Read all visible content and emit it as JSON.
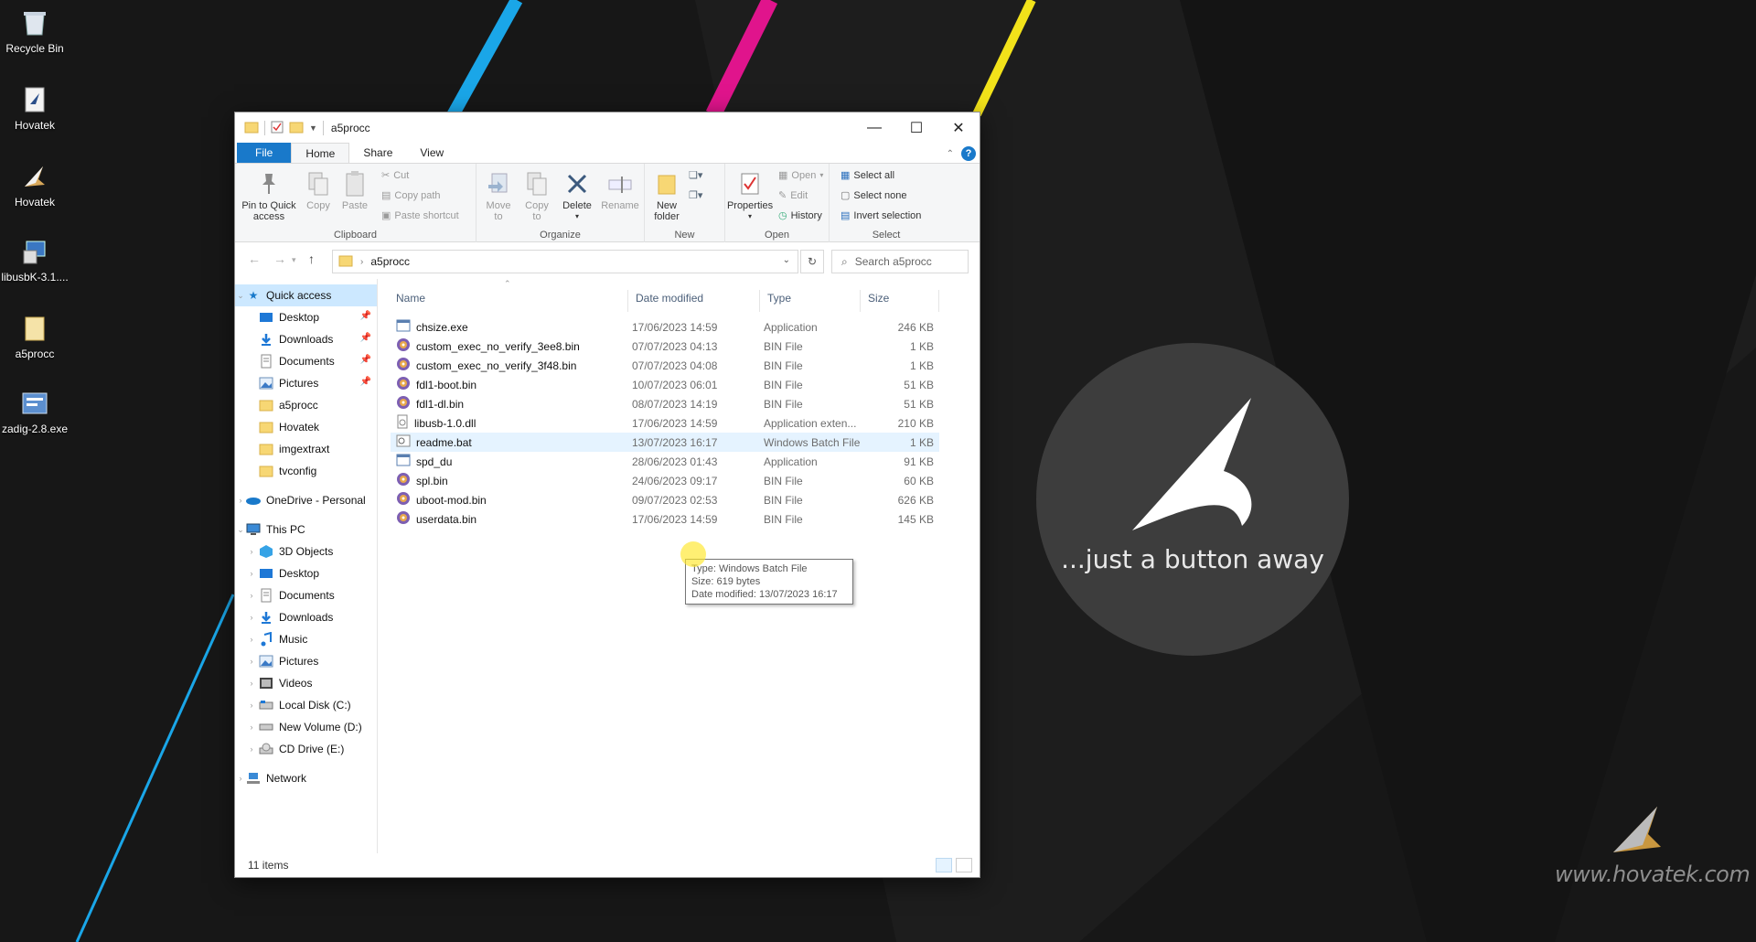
{
  "desktop": {
    "icons": [
      {
        "label": "Recycle Bin",
        "icon": "recycle-bin-icon"
      },
      {
        "label": "Hovatek",
        "icon": "hovatek-file-icon"
      },
      {
        "label": "Hovatek",
        "icon": "hovatek-logo-icon"
      },
      {
        "label": "libusbK-3.1....",
        "icon": "installer-icon"
      },
      {
        "label": "a5procc",
        "icon": "folder-icon"
      },
      {
        "label": "zadig-2.8.exe",
        "icon": "zadig-app-icon"
      }
    ]
  },
  "window": {
    "title": "a5procc",
    "controls": {
      "minimize": "—",
      "maximize": "☐",
      "close": "✕"
    }
  },
  "tabs": {
    "file": "File",
    "home": "Home",
    "share": "Share",
    "view": "View"
  },
  "ribbon": {
    "clipboard": {
      "group_label": "Clipboard",
      "pin_label_line1": "Pin to Quick",
      "pin_label_line2": "access",
      "copy": "Copy",
      "paste": "Paste",
      "cut": "Cut",
      "copy_path": "Copy path",
      "paste_shortcut": "Paste shortcut"
    },
    "organize": {
      "group_label": "Organize",
      "move_to_line1": "Move",
      "move_to_line2": "to",
      "copy_to_line1": "Copy",
      "copy_to_line2": "to",
      "delete": "Delete",
      "rename": "Rename"
    },
    "new": {
      "group_label": "New",
      "new_folder_line1": "New",
      "new_folder_line2": "folder"
    },
    "open": {
      "group_label": "Open",
      "properties": "Properties",
      "open": "Open",
      "edit": "Edit",
      "history": "History"
    },
    "select": {
      "group_label": "Select",
      "select_all": "Select all",
      "select_none": "Select none",
      "invert_selection": "Invert selection"
    }
  },
  "address": {
    "crumb": "a5procc",
    "search_placeholder": "Search a5procc"
  },
  "nav": {
    "quick_access": "Quick access",
    "pinned": [
      {
        "label": "Desktop",
        "icon": "desktop-icon",
        "pinned": true
      },
      {
        "label": "Downloads",
        "icon": "downloads-icon",
        "pinned": true
      },
      {
        "label": "Documents",
        "icon": "documents-icon",
        "pinned": true
      },
      {
        "label": "Pictures",
        "icon": "pictures-icon",
        "pinned": true
      },
      {
        "label": "a5procc",
        "icon": "folder-icon",
        "pinned": false
      },
      {
        "label": "Hovatek",
        "icon": "folder-icon",
        "pinned": false
      },
      {
        "label": "imgextraxt",
        "icon": "folder-icon",
        "pinned": false
      },
      {
        "label": "tvconfig",
        "icon": "folder-icon",
        "pinned": false
      }
    ],
    "onedrive": "OneDrive - Personal",
    "this_pc": "This PC",
    "pc_items": [
      {
        "label": "3D Objects",
        "icon": "3d-objects-icon"
      },
      {
        "label": "Desktop",
        "icon": "desktop-icon"
      },
      {
        "label": "Documents",
        "icon": "documents-icon"
      },
      {
        "label": "Downloads",
        "icon": "downloads-icon"
      },
      {
        "label": "Music",
        "icon": "music-icon"
      },
      {
        "label": "Pictures",
        "icon": "pictures-icon"
      },
      {
        "label": "Videos",
        "icon": "videos-icon"
      },
      {
        "label": "Local Disk (C:)",
        "icon": "local-disk-icon"
      },
      {
        "label": "New Volume (D:)",
        "icon": "drive-icon"
      },
      {
        "label": "CD Drive (E:)",
        "icon": "cd-drive-icon"
      }
    ],
    "network": "Network"
  },
  "columns": {
    "name": "Name",
    "date": "Date modified",
    "type": "Type",
    "size": "Size"
  },
  "files": [
    {
      "name": "chsize.exe",
      "date": "17/06/2023 14:59",
      "type": "Application",
      "size": "246 KB",
      "icon": "exe-icon"
    },
    {
      "name": "custom_exec_no_verify_3ee8.bin",
      "date": "07/07/2023 04:13",
      "type": "BIN File",
      "size": "1 KB",
      "icon": "bin-icon"
    },
    {
      "name": "custom_exec_no_verify_3f48.bin",
      "date": "07/07/2023 04:08",
      "type": "BIN File",
      "size": "1 KB",
      "icon": "bin-icon"
    },
    {
      "name": "fdl1-boot.bin",
      "date": "10/07/2023 06:01",
      "type": "BIN File",
      "size": "51 KB",
      "icon": "bin-icon"
    },
    {
      "name": "fdl1-dl.bin",
      "date": "08/07/2023 14:19",
      "type": "BIN File",
      "size": "51 KB",
      "icon": "bin-icon"
    },
    {
      "name": "libusb-1.0.dll",
      "date": "17/06/2023 14:59",
      "type": "Application exten...",
      "size": "210 KB",
      "icon": "dll-icon"
    },
    {
      "name": "readme.bat",
      "date": "13/07/2023 16:17",
      "type": "Windows Batch File",
      "size": "1 KB",
      "icon": "bat-icon"
    },
    {
      "name": "spd_du",
      "date": "28/06/2023 01:43",
      "type": "Application",
      "size": "91 KB",
      "icon": "exe-icon"
    },
    {
      "name": "spl.bin",
      "date": "24/06/2023 09:17",
      "type": "BIN File",
      "size": "60 KB",
      "icon": "bin-icon"
    },
    {
      "name": "uboot-mod.bin",
      "date": "09/07/2023 02:53",
      "type": "BIN File",
      "size": "626 KB",
      "icon": "bin-icon"
    },
    {
      "name": "userdata.bin",
      "date": "17/06/2023 14:59",
      "type": "BIN File",
      "size": "145 KB",
      "icon": "bin-icon"
    }
  ],
  "tooltip": {
    "type": "Type: Windows Batch File",
    "size": "Size: 619 bytes",
    "date": "Date modified: 13/07/2023 16:17"
  },
  "status": {
    "count": "11 items"
  },
  "branding": {
    "tagline": "...just a button away",
    "watermark": "www.hovatek.com"
  },
  "colors": {
    "accent": "#1979ca",
    "selection": "#cce8ff",
    "stripe_blue": "#1aa6e8",
    "stripe_magenta": "#e0148c",
    "stripe_yellow": "#f2e21a"
  }
}
